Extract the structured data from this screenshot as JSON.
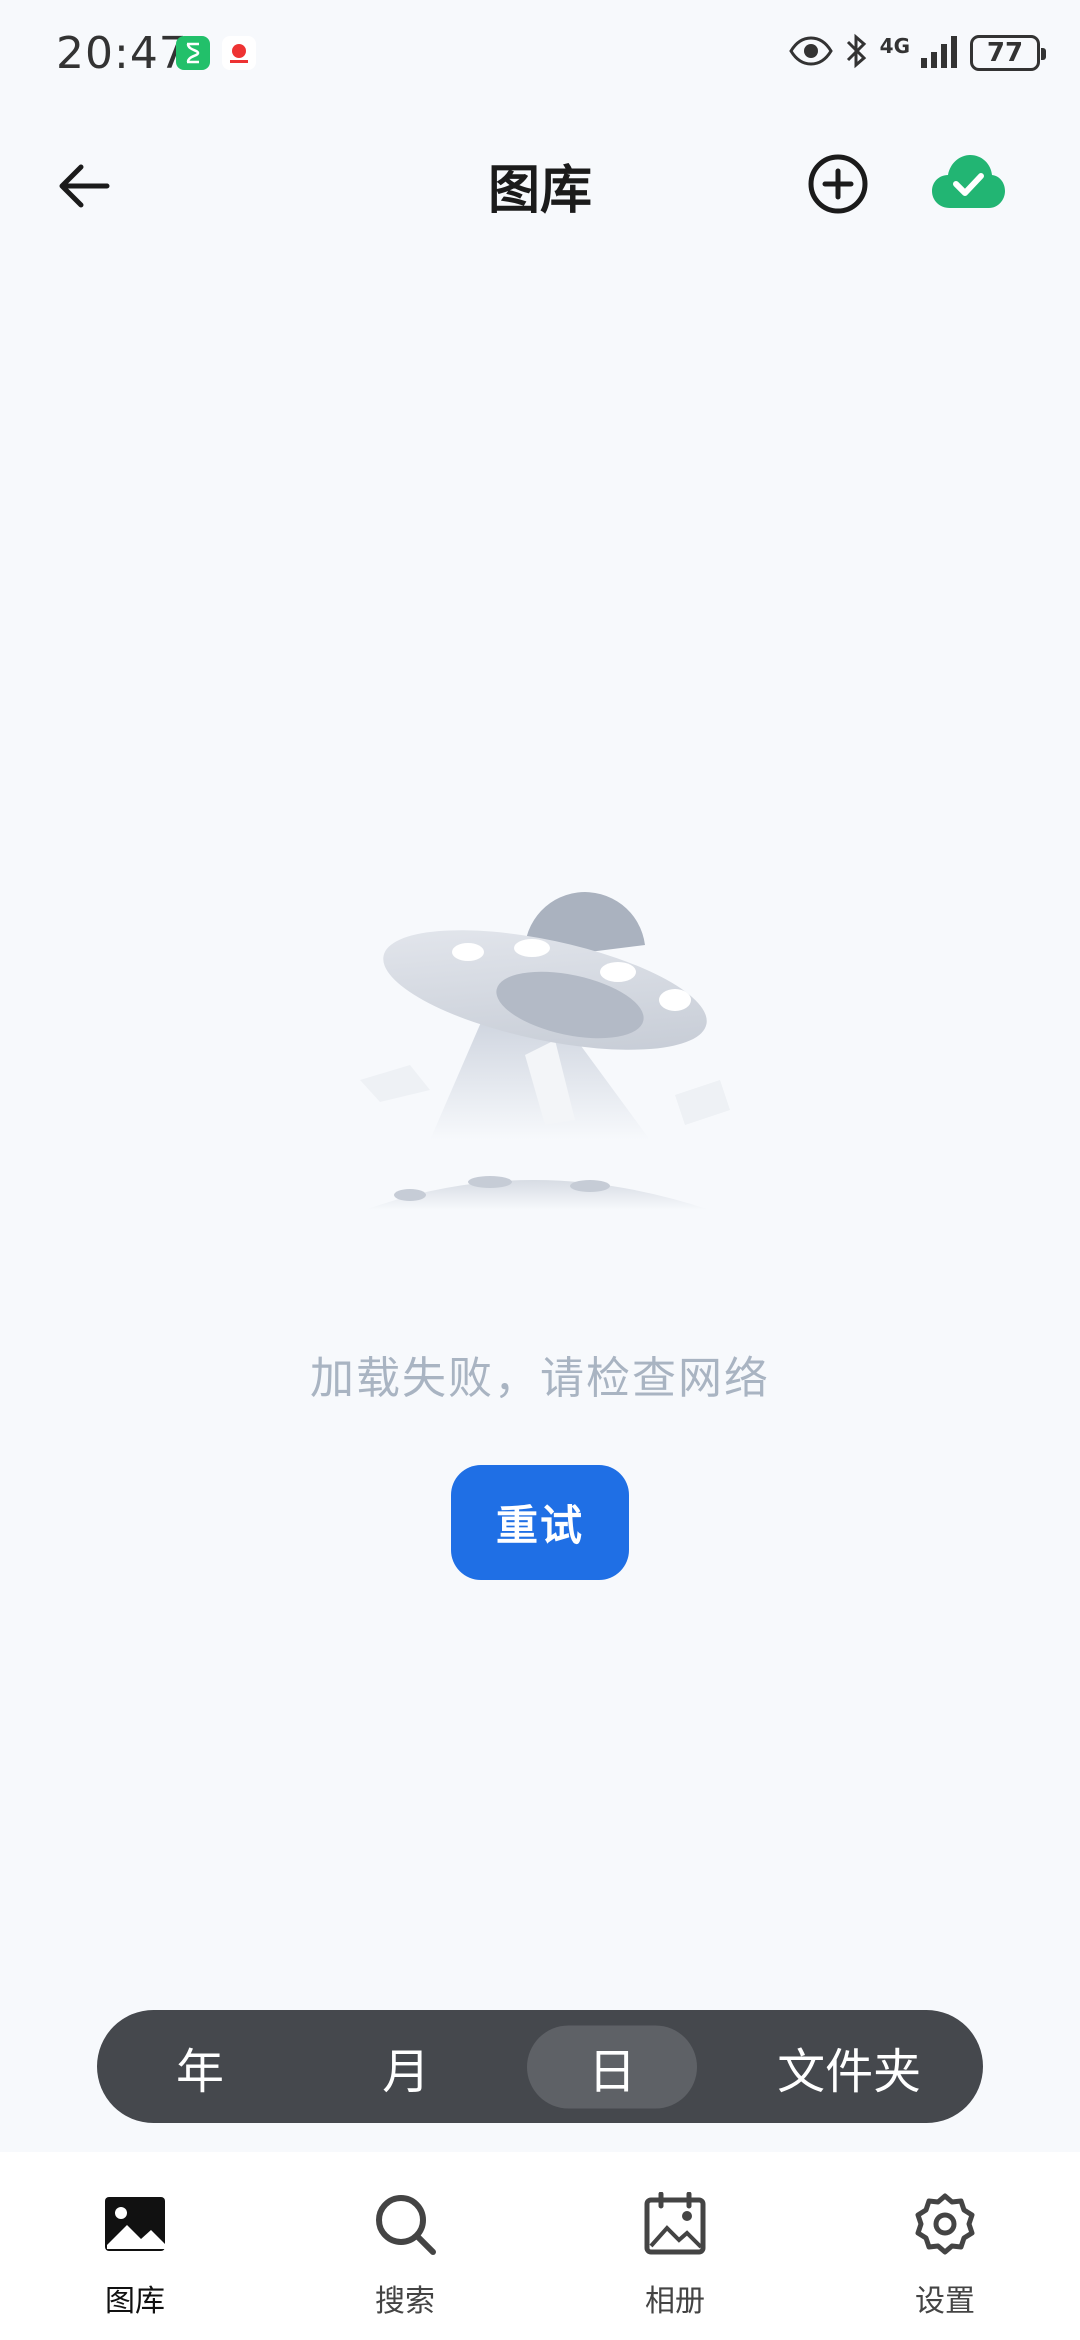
{
  "status_bar": {
    "time": "20:47",
    "network": "4G",
    "battery": "77"
  },
  "header": {
    "title": "图库"
  },
  "empty_state": {
    "message": "加载失败，请检查网络",
    "retry_label": "重试"
  },
  "view_switcher": {
    "items": [
      "年",
      "月",
      "日",
      "文件夹"
    ],
    "active": "日"
  },
  "bottom_nav": {
    "items": [
      {
        "label": "图库",
        "icon": "gallery-icon",
        "active": true
      },
      {
        "label": "搜索",
        "icon": "search-icon",
        "active": false
      },
      {
        "label": "相册",
        "icon": "album-icon",
        "active": false
      },
      {
        "label": "设置",
        "icon": "settings-icon",
        "active": false
      }
    ]
  },
  "colors": {
    "accent": "#1f6fe5",
    "cloud_green": "#22b573",
    "switcher_bg": "#45484d"
  }
}
